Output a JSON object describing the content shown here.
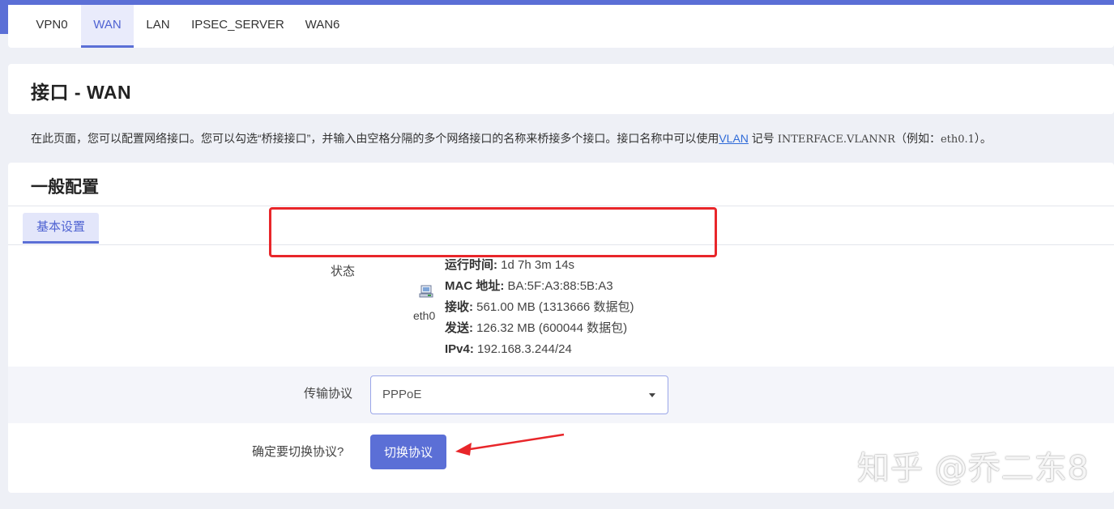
{
  "tabs": [
    {
      "label": "VPN0",
      "active": false
    },
    {
      "label": "WAN",
      "active": true
    },
    {
      "label": "LAN",
      "active": false
    },
    {
      "label": "IPSEC_SERVER",
      "active": false
    },
    {
      "label": "WAN6",
      "active": false
    }
  ],
  "page": {
    "title": "接口 - WAN",
    "description": {
      "part1": "在此页面，您可以配置网络接口。您可以勾选“桥接接口”，并输入由空格分隔的多个网络接口的名称来桥接多个接口。接口名称中可以使用",
      "link": "VLAN",
      "part2": " 记号 ",
      "code": "INTERFACE.VLANNR",
      "part3": "（例如：",
      "example": "eth0.1",
      "part4": "）。"
    }
  },
  "section": {
    "title": "一般配置",
    "subtab": "基本设置",
    "status": {
      "label": "状态",
      "device": "eth0",
      "device_icon": "network-port-icon",
      "uptime_label": "运行时间:",
      "uptime": " 1d 7h 3m 14s",
      "mac_label": "MAC 地址:",
      "mac": " BA:5F:A3:88:5B:A3",
      "rx_label": "接收:",
      "rx": " 561.00 MB (1313666 数据包)",
      "tx_label": "发送:",
      "tx": " 126.32 MB (600044 数据包)",
      "ipv4_label": "IPv4:",
      "ipv4": " 192.168.3.244/24"
    },
    "protocol": {
      "label": "传输协议",
      "value": "PPPoE"
    },
    "switch": {
      "confirm_label": "确定要切换协议?",
      "button": "切换协议"
    }
  },
  "watermark": "知乎 @乔二东8",
  "colors": {
    "accent": "#5b6fd6",
    "highlight": "#e8262a",
    "background": "#eef0f6"
  }
}
